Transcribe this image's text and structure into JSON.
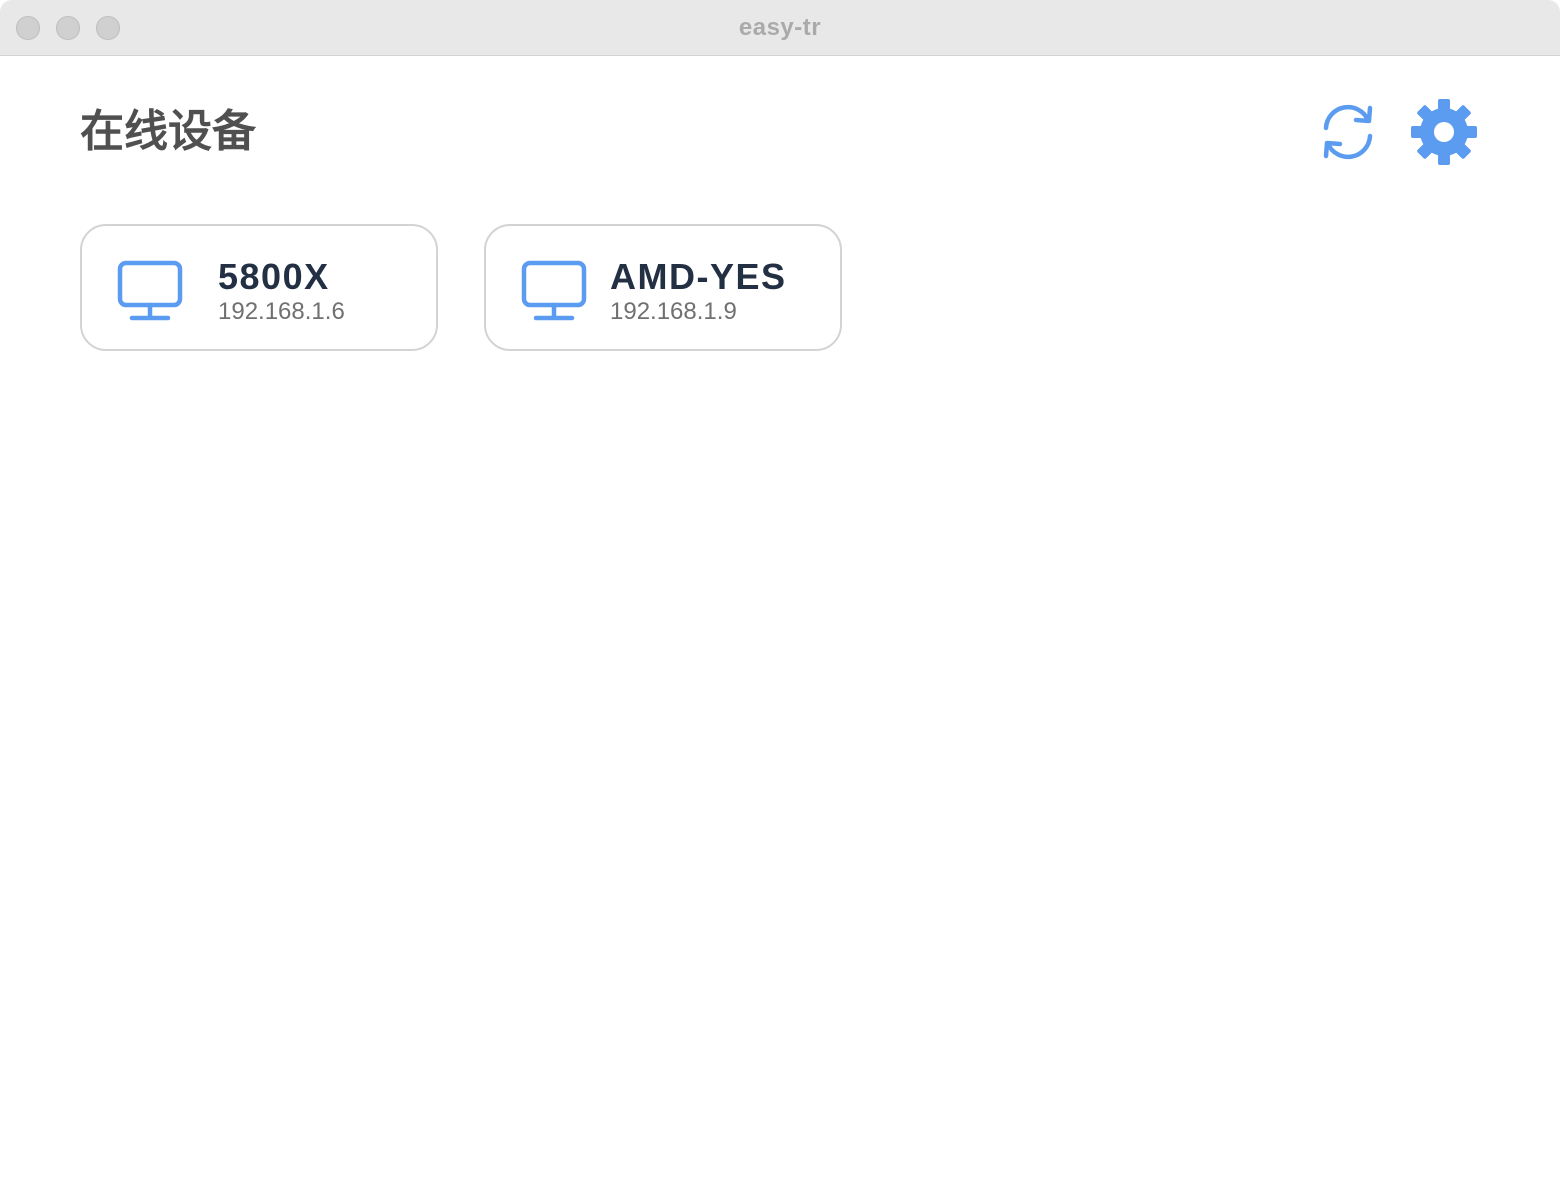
{
  "window": {
    "title": "easy-tr"
  },
  "header": {
    "title": "在线设备",
    "refresh_icon": "refresh-icon",
    "settings_icon": "gear-icon"
  },
  "devices": [
    {
      "name": "5800X",
      "ip": "192.168.1.6",
      "icon": "monitor-icon"
    },
    {
      "name": "AMD-YES",
      "ip": "192.168.1.9",
      "icon": "monitor-icon"
    }
  ],
  "colors": {
    "accent": "#5b9cf0",
    "title_text": "#505050",
    "device_name": "#233044",
    "device_ip": "#707070",
    "card_border": "#d3d3d3",
    "titlebar": "#e7e8e7"
  }
}
